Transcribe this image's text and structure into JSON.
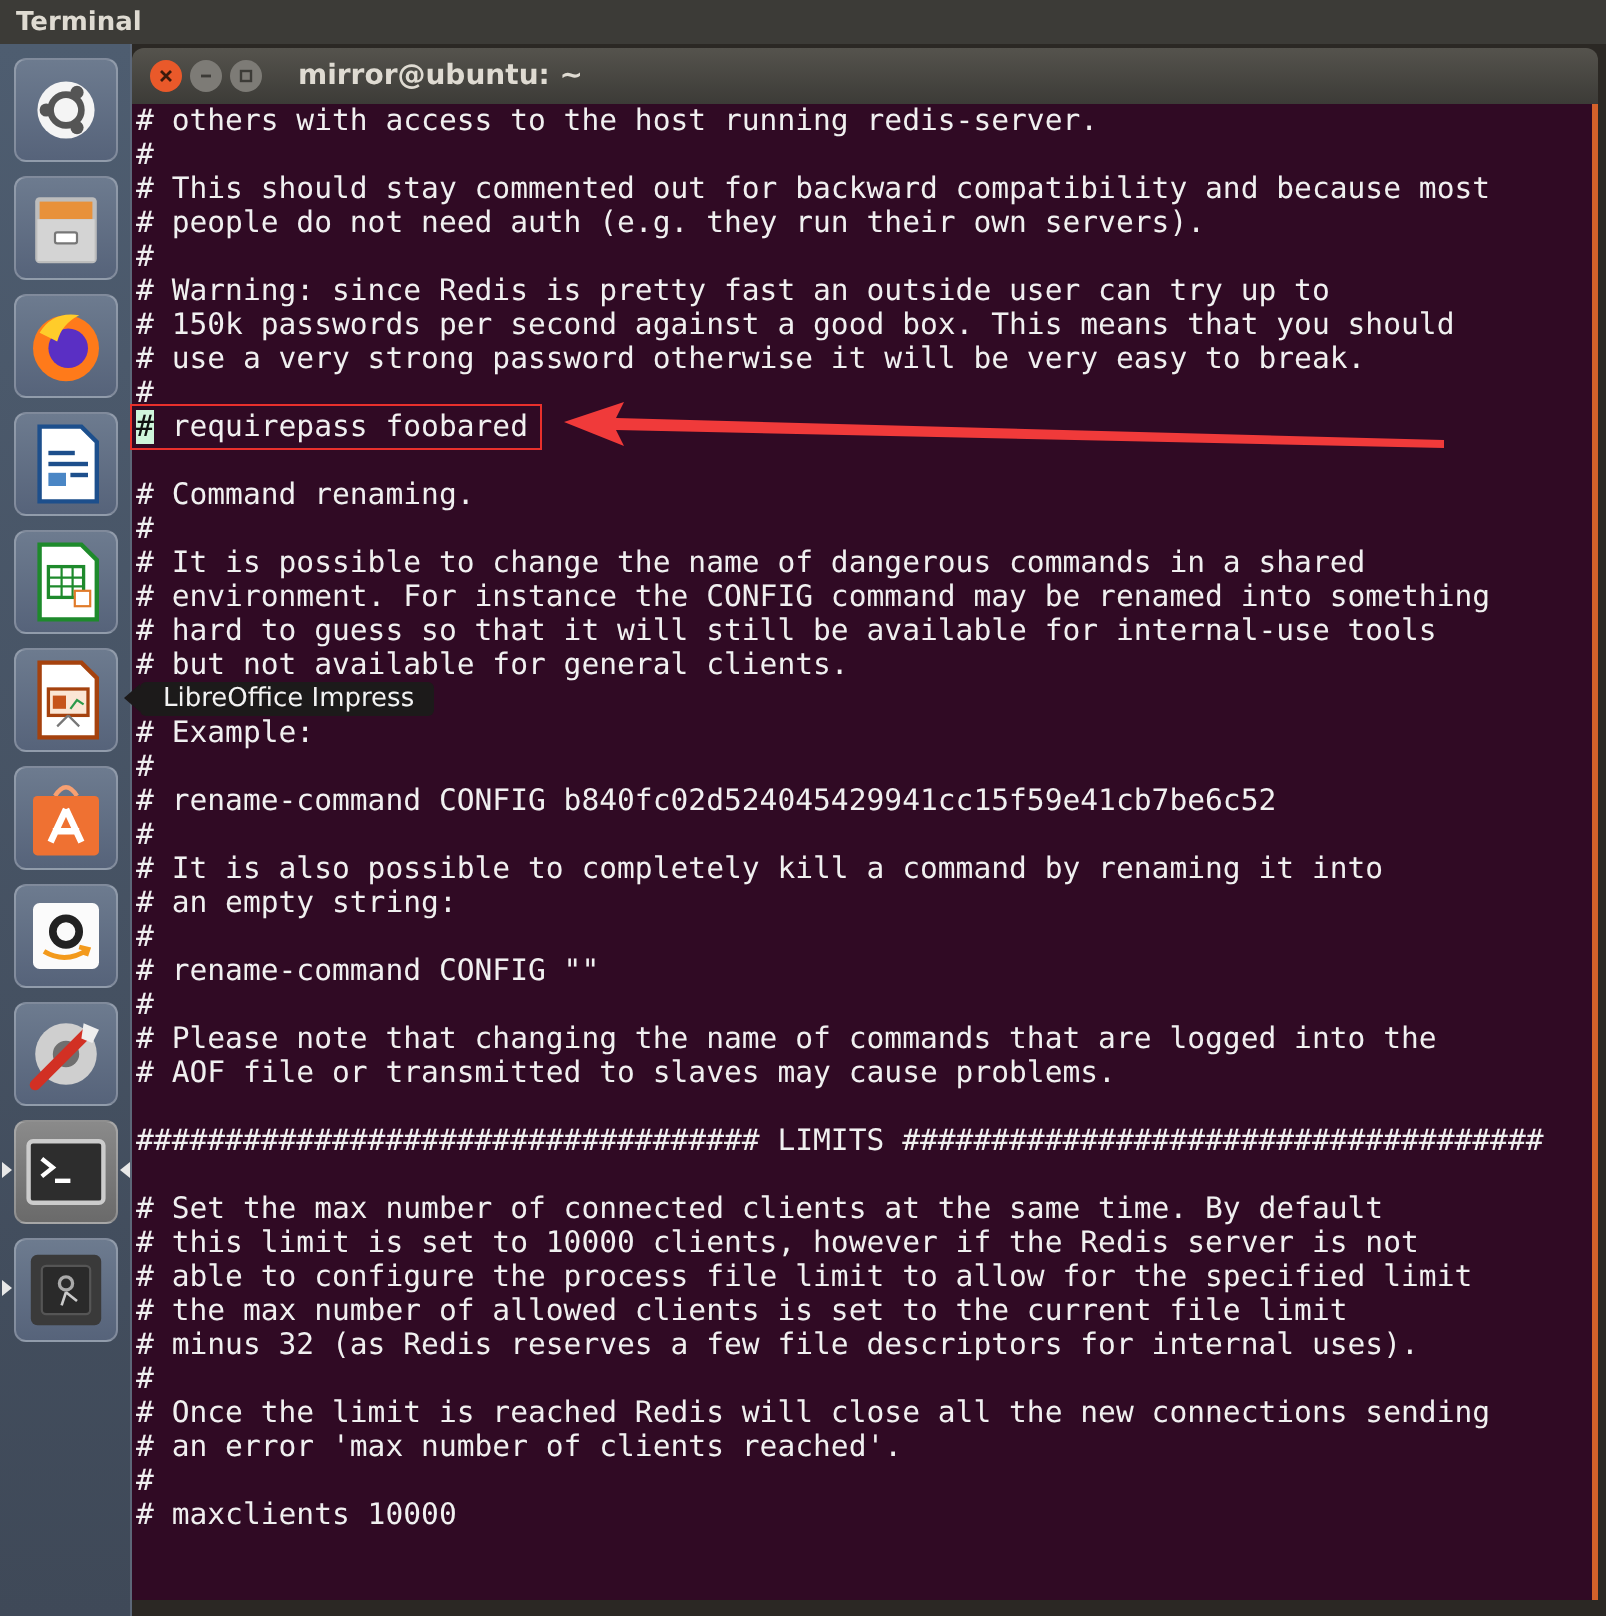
{
  "top_bar": {
    "title": "Terminal"
  },
  "launcher": {
    "items": [
      {
        "kind": "ubuntu",
        "running": false,
        "focused": false
      },
      {
        "kind": "files",
        "running": false,
        "focused": false
      },
      {
        "kind": "firefox",
        "running": false,
        "focused": false
      },
      {
        "kind": "writer",
        "running": false,
        "focused": false
      },
      {
        "kind": "calc",
        "running": false,
        "focused": false
      },
      {
        "kind": "impress",
        "running": false,
        "focused": false,
        "tooltip": "LibreOffice Impress"
      },
      {
        "kind": "store",
        "running": false,
        "focused": false
      },
      {
        "kind": "amazon",
        "running": false,
        "focused": false
      },
      {
        "kind": "tools",
        "running": false,
        "focused": false
      },
      {
        "kind": "terminal",
        "running": true,
        "focused": true
      },
      {
        "kind": "disk",
        "running": true,
        "focused": false
      }
    ]
  },
  "window": {
    "title": "mirror@ubuntu: ~"
  },
  "terminal": {
    "lines": [
      {
        "kind": "text",
        "text": "# others with access to the host running redis-server."
      },
      {
        "kind": "text",
        "text": "#"
      },
      {
        "kind": "text",
        "text": "# This should stay commented out for backward compatibility and because most"
      },
      {
        "kind": "text",
        "text": "# people do not need auth (e.g. they run their own servers)."
      },
      {
        "kind": "text",
        "text": "#"
      },
      {
        "kind": "text",
        "text": "# Warning: since Redis is pretty fast an outside user can try up to"
      },
      {
        "kind": "text",
        "text": "# 150k passwords per second against a good box. This means that you should"
      },
      {
        "kind": "text",
        "text": "# use a very strong password otherwise it will be very easy to break."
      },
      {
        "kind": "text",
        "text": "#"
      },
      {
        "kind": "highlight",
        "text": "# requirepass foobared",
        "cursor": true
      },
      {
        "kind": "blank"
      },
      {
        "kind": "text",
        "text": "# Command renaming."
      },
      {
        "kind": "text",
        "text": "#"
      },
      {
        "kind": "text",
        "text": "# It is possible to change the name of dangerous commands in a shared"
      },
      {
        "kind": "text",
        "text": "# environment. For instance the CONFIG command may be renamed into something"
      },
      {
        "kind": "text",
        "text": "# hard to guess so that it will still be available for internal-use tools"
      },
      {
        "kind": "text",
        "text": "# but not available for general clients."
      },
      {
        "kind": "blank"
      },
      {
        "kind": "text",
        "text": "# Example:"
      },
      {
        "kind": "text",
        "text": "#"
      },
      {
        "kind": "text",
        "text": "# rename-command CONFIG b840fc02d524045429941cc15f59e41cb7be6c52"
      },
      {
        "kind": "text",
        "text": "#"
      },
      {
        "kind": "text",
        "text": "# It is also possible to completely kill a command by renaming it into"
      },
      {
        "kind": "text",
        "text": "# an empty string:"
      },
      {
        "kind": "text",
        "text": "#"
      },
      {
        "kind": "text",
        "text": "# rename-command CONFIG \"\""
      },
      {
        "kind": "text",
        "text": "#"
      },
      {
        "kind": "text",
        "text": "# Please note that changing the name of commands that are logged into the"
      },
      {
        "kind": "text",
        "text": "# AOF file or transmitted to slaves may cause problems."
      },
      {
        "kind": "blank"
      },
      {
        "kind": "text",
        "text": "################################### LIMITS ####################################"
      },
      {
        "kind": "blank"
      },
      {
        "kind": "text",
        "text": "# Set the max number of connected clients at the same time. By default"
      },
      {
        "kind": "text",
        "text": "# this limit is set to 10000 clients, however if the Redis server is not"
      },
      {
        "kind": "text",
        "text": "# able to configure the process file limit to allow for the specified limit"
      },
      {
        "kind": "text",
        "text": "# the max number of allowed clients is set to the current file limit"
      },
      {
        "kind": "text",
        "text": "# minus 32 (as Redis reserves a few file descriptors for internal uses)."
      },
      {
        "kind": "text",
        "text": "#"
      },
      {
        "kind": "text",
        "text": "# Once the limit is reached Redis will close all the new connections sending"
      },
      {
        "kind": "text",
        "text": "# an error 'max number of clients reached'."
      },
      {
        "kind": "text",
        "text": "#"
      },
      {
        "kind": "text",
        "text": "# maxclients 10000"
      }
    ]
  }
}
